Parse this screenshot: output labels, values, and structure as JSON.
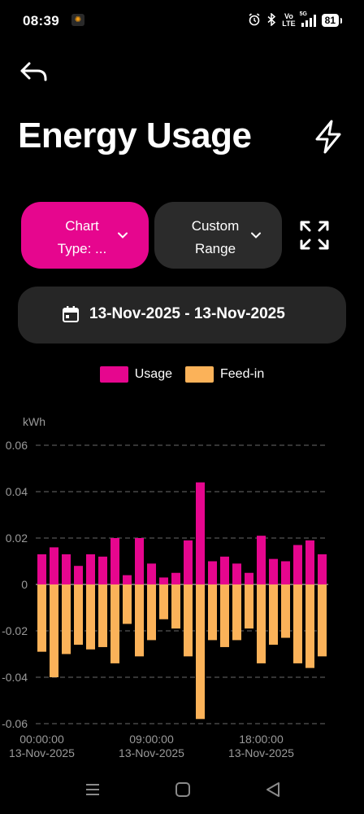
{
  "status_bar": {
    "time": "08:39",
    "network_5g": "5G",
    "volte_top": "Vo",
    "volte_bottom": "LTE",
    "battery": "81"
  },
  "header": {
    "title": "Energy Usage",
    "back_icon": "back-arrow-icon",
    "action_icon": "lightning-bolt-icon"
  },
  "controls": {
    "chart_type_line1": "Chart",
    "chart_type_line2": "Type: ...",
    "custom_range_line1": "Custom",
    "custom_range_line2": "Range",
    "date_range": "13-Nov-2025 - 13-Nov-2025"
  },
  "colors": {
    "usage": "#e6068e",
    "feed_in": "#fbb259",
    "background": "#000000"
  },
  "legend": [
    {
      "label": "Usage",
      "color": "#e6068e"
    },
    {
      "label": "Feed-in",
      "color": "#fbb259"
    }
  ],
  "chart_data": {
    "type": "bar",
    "ylabel": "kWh",
    "ylim": [
      -0.06,
      0.06
    ],
    "yticks": [
      "0.06",
      "0.04",
      "0.02",
      "0",
      "-0.02",
      "-0.04",
      "-0.06"
    ],
    "xtick_labels": [
      {
        "time": "00:00:00",
        "date": "13-Nov-2025",
        "index": 0
      },
      {
        "time": "09:00:00",
        "date": "13-Nov-2025",
        "index": 9
      },
      {
        "time": "18:00:00",
        "date": "13-Nov-2025",
        "index": 18
      }
    ],
    "grid": true,
    "legend_position": "top-center",
    "series": [
      {
        "name": "Usage",
        "values": [
          0.013,
          0.016,
          0.013,
          0.008,
          0.013,
          0.012,
          0.02,
          0.004,
          0.02,
          0.009,
          0.003,
          0.005,
          0.019,
          0.044,
          0.01,
          0.012,
          0.009,
          0.005,
          0.021,
          0.011,
          0.01,
          0.017,
          0.019,
          0.013
        ]
      },
      {
        "name": "Feed-in",
        "values": [
          -0.029,
          -0.04,
          -0.03,
          -0.026,
          -0.028,
          -0.027,
          -0.034,
          -0.017,
          -0.031,
          -0.024,
          -0.015,
          -0.019,
          -0.031,
          -0.058,
          -0.024,
          -0.027,
          -0.024,
          -0.019,
          -0.034,
          -0.026,
          -0.023,
          -0.034,
          -0.036,
          -0.031
        ]
      }
    ]
  }
}
